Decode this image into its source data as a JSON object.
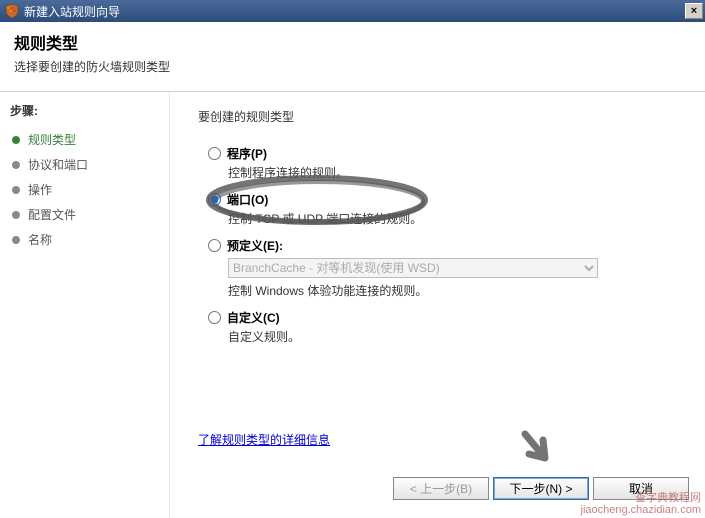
{
  "window": {
    "title": "新建入站规则向导"
  },
  "header": {
    "title": "规则类型",
    "subtitle": "选择要创建的防火墙规则类型"
  },
  "sidebar": {
    "steps_label": "步骤:",
    "steps": [
      {
        "label": "规则类型",
        "state": "current"
      },
      {
        "label": "协议和端口",
        "state": "pending"
      },
      {
        "label": "操作",
        "state": "pending"
      },
      {
        "label": "配置文件",
        "state": "pending"
      },
      {
        "label": "名称",
        "state": "pending"
      }
    ]
  },
  "main": {
    "section_title": "要创建的规则类型",
    "options": [
      {
        "key": "program",
        "label": "程序(P)",
        "desc": "控制程序连接的规则。",
        "checked": false,
        "disabled": false
      },
      {
        "key": "port",
        "label": "端口(O)",
        "desc": "控制 TCP 或 UDP 端口连接的规则。",
        "checked": true,
        "disabled": false
      },
      {
        "key": "predefined",
        "label": "预定义(E):",
        "desc": "控制 Windows 体验功能连接的规则。",
        "checked": false,
        "disabled": false
      },
      {
        "key": "custom",
        "label": "自定义(C)",
        "desc": "自定义规则。",
        "checked": false,
        "disabled": false
      }
    ],
    "predefined_select": {
      "value": "BranchCache - 对等机发现(使用 WSD)",
      "disabled": true
    },
    "learn_more": "了解规则类型的详细信息"
  },
  "buttons": {
    "back": "< 上一步(B)",
    "next": "下一步(N) >",
    "cancel": "取消"
  },
  "watermark": {
    "line1": "查字典教程网",
    "line2": "jiaocheng.chazidian.com"
  }
}
